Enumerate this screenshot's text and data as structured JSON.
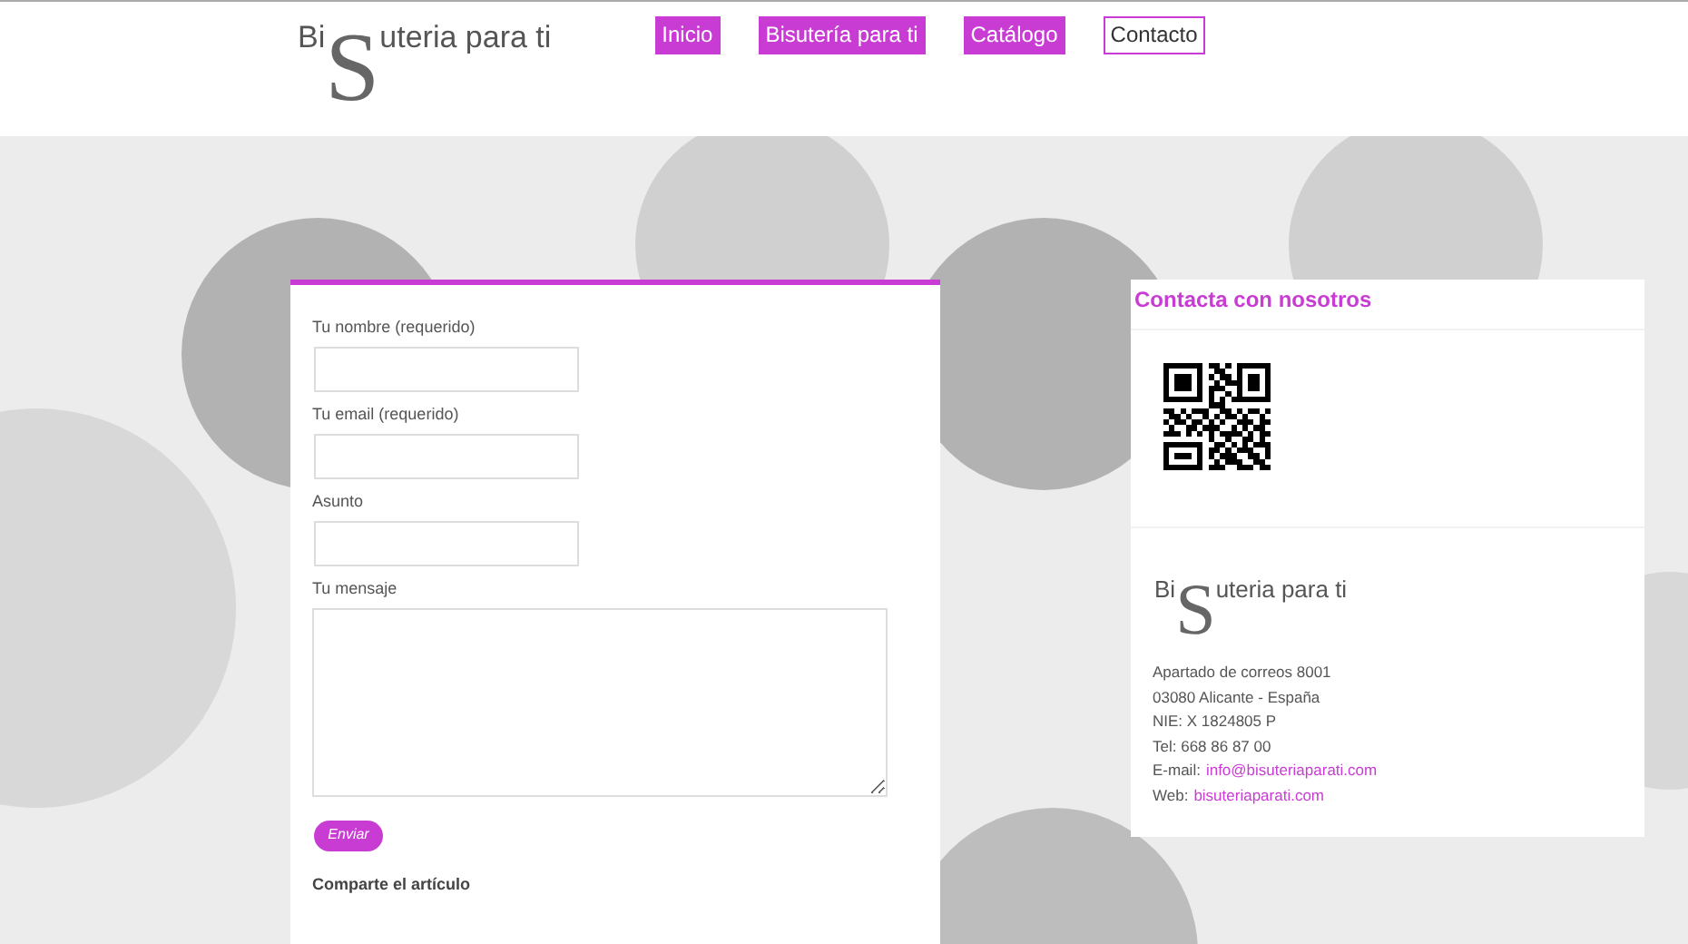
{
  "logo": {
    "before": "Bi",
    "initial": "S",
    "after": "uteria para ti"
  },
  "nav": [
    {
      "label": "Inicio",
      "selected": false
    },
    {
      "label": "Bisutería para ti",
      "selected": false
    },
    {
      "label": "Catálogo",
      "selected": false
    },
    {
      "label": "Contacto",
      "selected": true
    }
  ],
  "form": {
    "fields": [
      {
        "label": "Tu nombre (requerido)",
        "kind": "input"
      },
      {
        "label": "Tu email (requerido)",
        "kind": "input"
      },
      {
        "label": "Asunto",
        "kind": "input"
      },
      {
        "label": "Tu mensaje",
        "kind": "textarea"
      }
    ],
    "submit": "Enviar",
    "share_heading": "Comparte el artículo"
  },
  "sidebar": {
    "title": "Contacta con nosotros",
    "logo": {
      "before": "Bi",
      "initial": "S",
      "after": "uteria para ti"
    },
    "lines": [
      {
        "text": "Apartado de correos 8001"
      },
      {
        "text": "03080 Alicante - España"
      },
      {
        "text": "NIE: X 1824805 P"
      },
      {
        "text": "Tel: 668 86 87 00"
      },
      {
        "text": "E-mail:",
        "link": "info@bisuteriaparati.com"
      },
      {
        "text": "Web:",
        "link": "bisuteriaparati.com"
      }
    ]
  }
}
